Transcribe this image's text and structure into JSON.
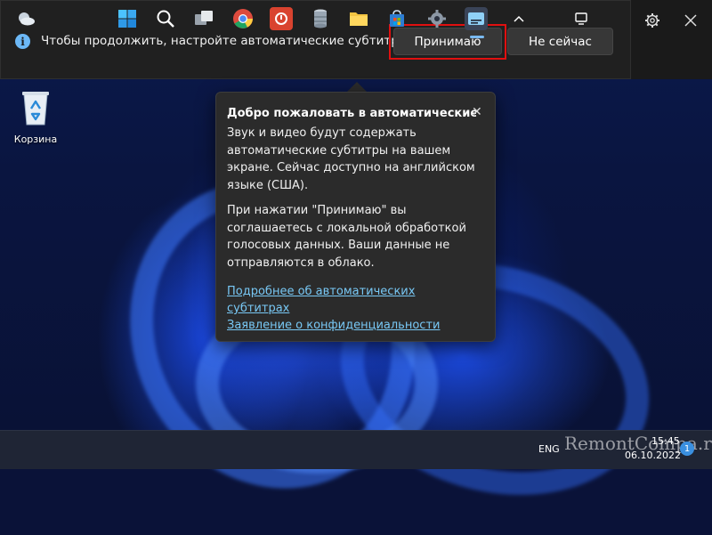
{
  "caption_bar": {
    "message": "Чтобы продолжить, настройте автоматические субтитры.",
    "accept_label": "Принимаю",
    "not_now_label": "Не сейчас",
    "info_icon": "info-icon",
    "settings_icon": "gear-icon",
    "close_icon": "close-icon"
  },
  "desktop": {
    "recycle_bin_label": "Корзина"
  },
  "flyout": {
    "title": "Добро пожаловать в автоматические субтитры",
    "paragraph1": "Звук и видео будут содержать автоматические субтитры на вашем экране. Сейчас доступно на английском языке (США).",
    "paragraph2": "При нажатии \"Принимаю\" вы соглашаетесь с локальной обработкой голосовых данных. Ваши данные не отправляются в облако.",
    "link_learn_more": "Подробнее об автоматических субтитрах",
    "link_privacy": "Заявление о конфиденциальности"
  },
  "taskbar": {
    "language": "ENG",
    "time": "15:45",
    "date": "06.10.2022",
    "notification_count": "1",
    "watermark": "RemontCompa.ru",
    "icons": [
      "weather-icon",
      "start-icon",
      "search-icon",
      "task-view-icon",
      "chrome-icon",
      "app-red-icon",
      "database-icon",
      "folder-icon",
      "store-icon",
      "settings-icon",
      "live-captions-icon",
      "chevron-up-icon",
      "network-icon"
    ]
  },
  "colors": {
    "accent_link": "#78c8f5",
    "highlight_frame": "#e01010",
    "panel_bg": "#202020",
    "flyout_bg": "#2b2b2b"
  }
}
